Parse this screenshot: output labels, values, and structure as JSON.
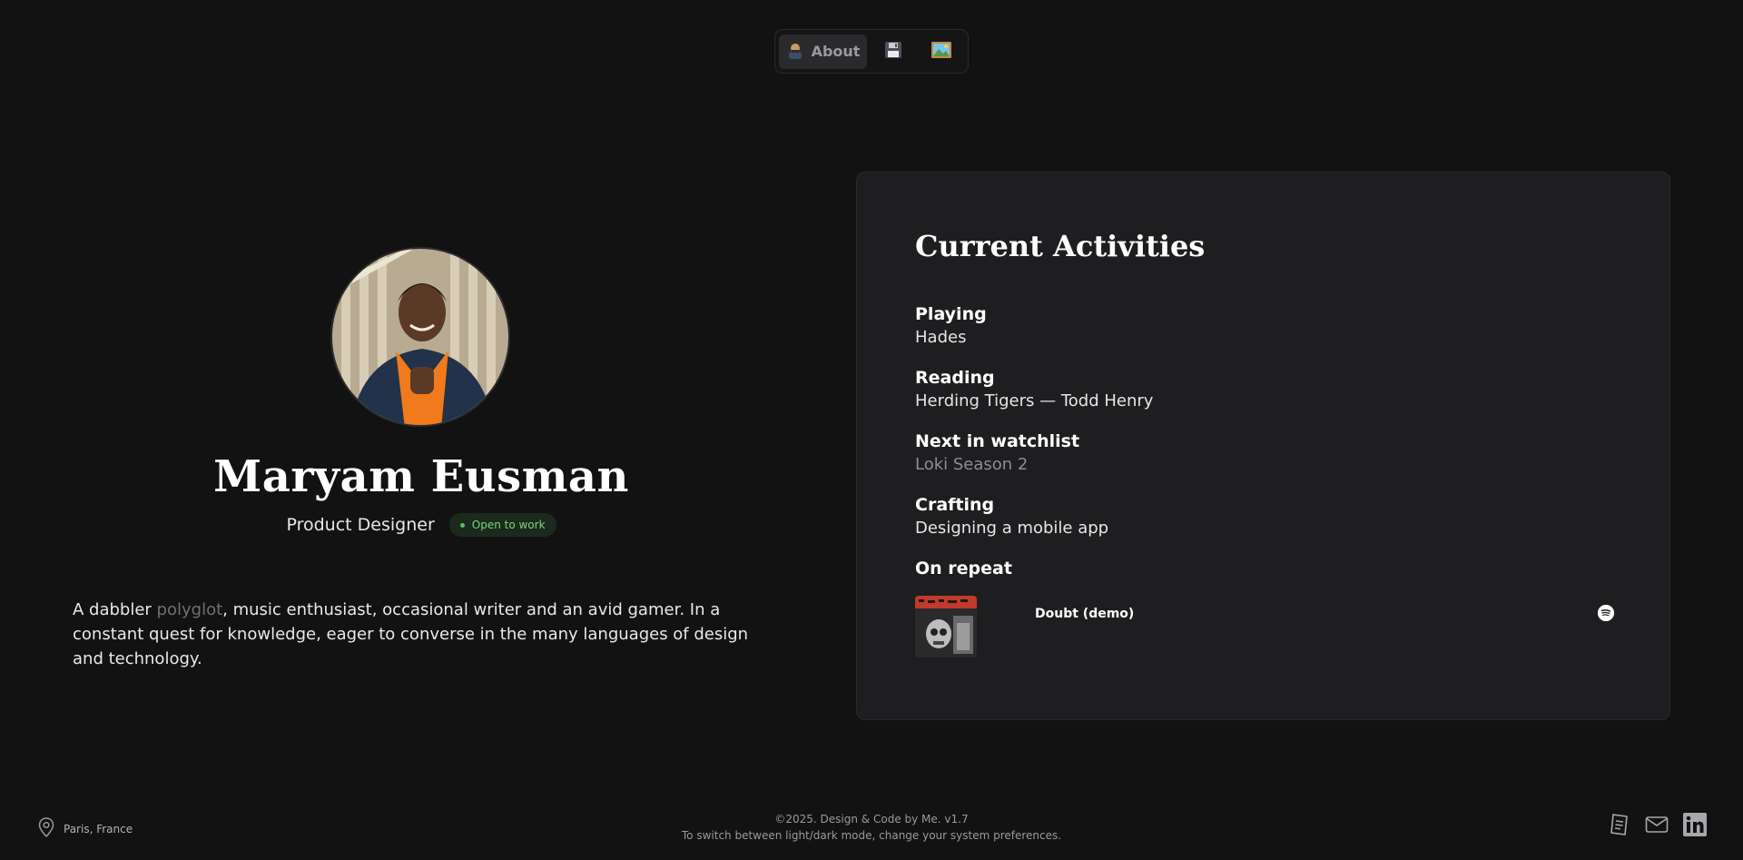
{
  "nav": {
    "about_label": "About",
    "about_icon": "person-emoji-icon",
    "tab2_icon": "floppy-disk-icon",
    "tab3_icon": "framed-picture-icon"
  },
  "profile": {
    "name": "Maryam Eusman",
    "role": "Product Designer",
    "status": "Open to work",
    "bio_prefix": "A dabbler ",
    "bio_highlight": "polyglot",
    "bio_suffix": ", music enthusiast, occasional writer and an avid gamer. In a constant quest for knowledge, eager to converse in the many languages of design and technology."
  },
  "activities": {
    "title": "Current Activities",
    "items": [
      {
        "label": "Playing",
        "value": "Hades"
      },
      {
        "label": "Reading",
        "value": "Herding Tigers — Todd Henry"
      },
      {
        "label": "Next in watchlist",
        "value": "Loki Season 2"
      },
      {
        "label": "Crafting",
        "value": "Designing a mobile app"
      },
      {
        "label": "On repeat",
        "value": ""
      }
    ],
    "track": {
      "name": "Doubt (demo)",
      "service_icon": "spotify-icon"
    }
  },
  "footer": {
    "location": "Paris, France",
    "copyright": "©2025. Design & Code by Me. v1.7",
    "note": "To switch between light/dark mode, change your system preferences."
  },
  "colors": {
    "background": "#121213",
    "card": "#1e1e20",
    "badge_bg": "#1b2a1d",
    "badge_text": "#7ad57e"
  }
}
